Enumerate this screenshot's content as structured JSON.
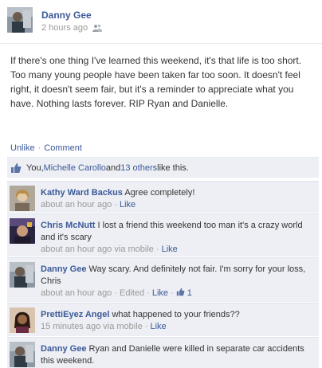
{
  "post": {
    "author": "Danny Gee",
    "time": "2 hours ago",
    "privacy_icon": "friends-icon",
    "body": "If there's one thing I've learned this weekend, it's that life is too short. Too many young people have been taken far too soon. It doesn't feel right, it doesn't seem fair, but it's a reminder to appreciate what you have. Nothing lasts forever. RIP Ryan and Danielle.",
    "actions": {
      "unlike": "Unlike",
      "separator": "·",
      "comment": "Comment"
    }
  },
  "likes": {
    "you": "You, ",
    "person": "Michelle Carollo",
    "and": " and ",
    "others": "13 others",
    "suffix": " like this."
  },
  "comments": [
    {
      "name": "Kathy Ward Backus",
      "text": " Agree completely!",
      "time": "about an hour ago",
      "via": "",
      "edited": "",
      "like": "Like",
      "like_count": ""
    },
    {
      "name": "Chris McNutt",
      "text": " I lost a friend this weekend too man it's a crazy world and it's scary",
      "time": "about an hour ago",
      "via": "via mobile",
      "edited": "",
      "like": "Like",
      "like_count": ""
    },
    {
      "name": "Danny Gee",
      "text": " Way scary. And definitely not fair. I'm sorry for your loss, Chris",
      "time": "about an hour ago",
      "via": "",
      "edited": "Edited",
      "like": "Like",
      "like_count": "1"
    },
    {
      "name": "PrettiEyez Angel",
      "text": " what happened to your friends??",
      "time": "15 minutes ago",
      "via": "via mobile",
      "edited": "",
      "like": "Like",
      "like_count": ""
    },
    {
      "name": "Danny Gee",
      "text": " Ryan and Danielle were killed in separate car accidents this weekend.",
      "time": "",
      "via": "",
      "edited": "",
      "like": "",
      "like_count": ""
    }
  ],
  "colors": {
    "link": "#3b5998",
    "comment_bg": "#edeff4",
    "meta": "#999999"
  }
}
